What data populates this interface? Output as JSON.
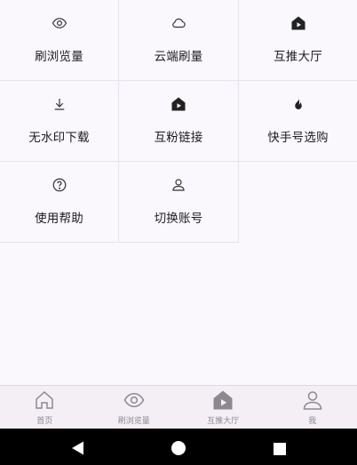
{
  "grid": {
    "items": [
      {
        "label": "刷浏览量",
        "icon": "eye-icon"
      },
      {
        "label": "云端刷量",
        "icon": "cloud-icon"
      },
      {
        "label": "互推大厅",
        "icon": "store-icon"
      },
      {
        "label": "无水印下载",
        "icon": "download-icon"
      },
      {
        "label": "互粉链接",
        "icon": "store-icon"
      },
      {
        "label": "快手号选购",
        "icon": "fire-icon"
      },
      {
        "label": "使用帮助",
        "icon": "help-icon"
      },
      {
        "label": "切换账号",
        "icon": "user-icon"
      }
    ]
  },
  "bottom_nav": {
    "items": [
      {
        "label": "首页",
        "icon": "home-icon"
      },
      {
        "label": "刷浏览量",
        "icon": "eye-icon"
      },
      {
        "label": "互推大厅",
        "icon": "store-icon"
      },
      {
        "label": "我",
        "icon": "user-icon"
      }
    ]
  },
  "system_bar": {
    "buttons": [
      "back-icon",
      "home-circle-icon",
      "recents-icon"
    ]
  },
  "colors": {
    "background": "#fbf8fd",
    "grid_line": "#e6e3ea",
    "nav_background": "#f3eff5",
    "nav_icon": "#8c8890",
    "text": "#1d1b20"
  }
}
